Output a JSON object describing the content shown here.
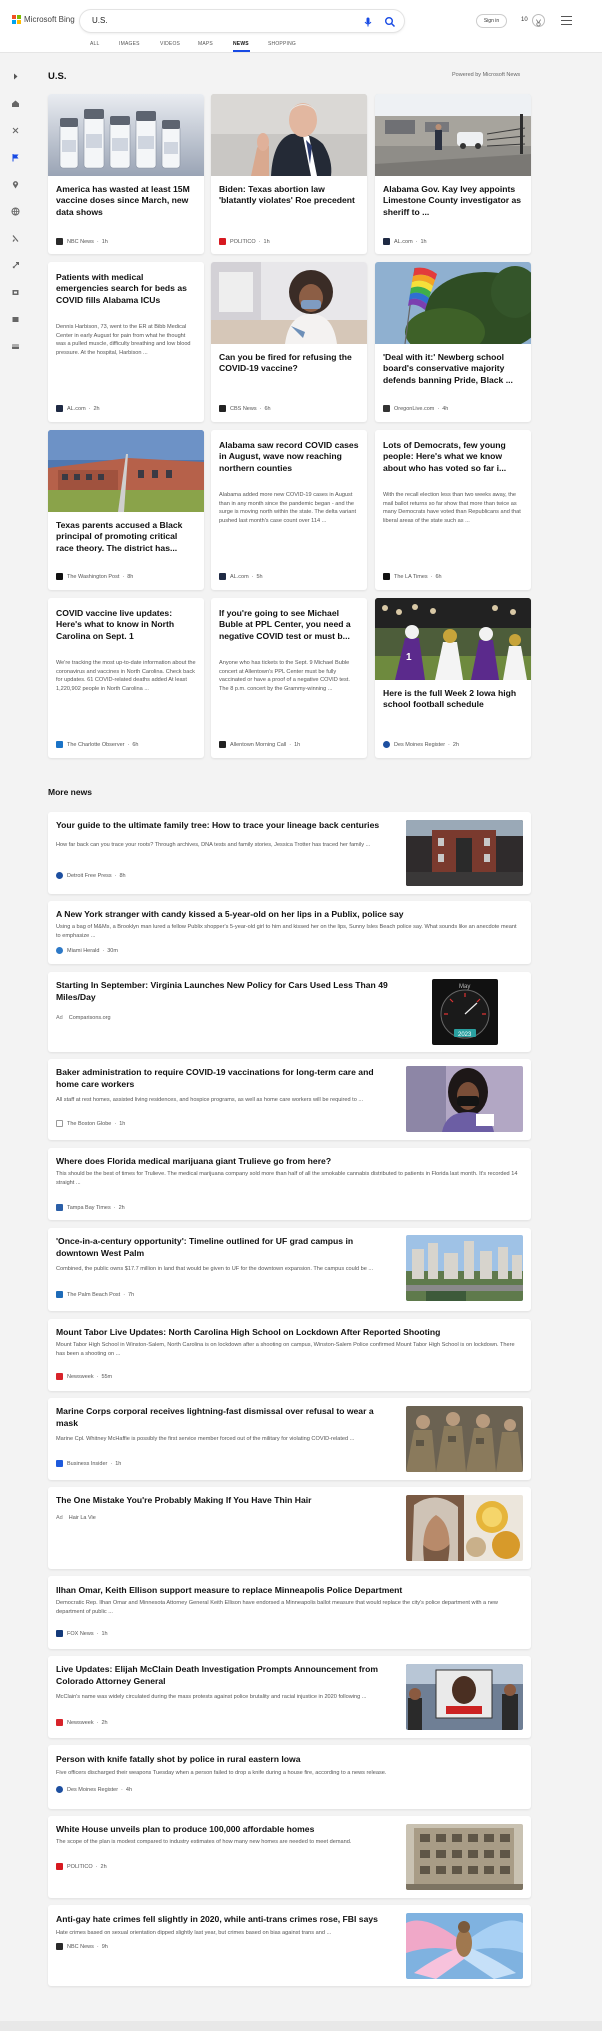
{
  "header": {
    "brand": "Microsoft Bing",
    "search_value": "U.S.",
    "sign_in": "Sign in",
    "points": "10"
  },
  "tabs": [
    {
      "label": "ALL",
      "active": false
    },
    {
      "label": "IMAGES",
      "active": false
    },
    {
      "label": "VIDEOS",
      "active": false
    },
    {
      "label": "MAPS",
      "active": false
    },
    {
      "label": "NEWS",
      "active": true
    },
    {
      "label": "SHOPPING",
      "active": false
    }
  ],
  "sidebar": {
    "icons": [
      "expand-icon",
      "home-icon",
      "sparkle-icon",
      "flag-icon",
      "location-pin-icon",
      "globe-icon",
      "briefcase-icon",
      "rocket-icon",
      "entertainment-icon",
      "sports-icon",
      "money-icon"
    ]
  },
  "section": {
    "title": "U.S.",
    "powered_by": "Powered by Microsoft News"
  },
  "cards": [
    {
      "title": "America has wasted at least 15M vaccine doses since March, new data shows",
      "snippet": "",
      "source": "NBC News",
      "time": "1h",
      "fav_color": "#2a2a2a"
    },
    {
      "title": "Biden: Texas abortion law 'blatantly violates' Roe precedent",
      "snippet": "",
      "source": "POLITICO",
      "time": "1h",
      "fav_color": "#d71920"
    },
    {
      "title": "Alabama Gov. Kay Ivey appoints Limestone County investigator as sheriff to ...",
      "snippet": "",
      "source": "AL.com",
      "time": "1h",
      "fav_color": "#1f2a44"
    },
    {
      "title": "Patients with medical emergencies search for beds as COVID fills Alabama ICUs",
      "snippet": "Dennis Harbison, 73, went to the ER at Bibb Medical Center in early August for pain from what he thought was a pulled muscle, difficulty breathing and low blood pressure. At the hospital, Harbison ...",
      "source": "AL.com",
      "time": "2h",
      "fav_color": "#1f2a44"
    },
    {
      "title": "Can you be fired for refusing the COVID-19 vaccine?",
      "snippet": "",
      "source": "CBS News",
      "time": "6h",
      "fav_color": "#222222"
    },
    {
      "title": "'Deal with it:' Newberg school board's conservative majority defends banning Pride, Black ...",
      "snippet": "",
      "source": "OregonLive.com",
      "time": "4h",
      "fav_color": "#333333"
    },
    {
      "title": "Texas parents accused a Black principal of promoting critical race theory. The district has...",
      "snippet": "",
      "source": "The Washington Post",
      "time": "8h",
      "fav_color": "#111111"
    },
    {
      "title": "Alabama saw record COVID cases in August, wave now reaching northern counties",
      "snippet": "Alabama added more new COVID-19 cases in August than in any month since the pandemic began - and the surge is moving north within the state. The delta variant pushed last month's case count over 114 ...",
      "source": "AL.com",
      "time": "5h",
      "fav_color": "#1f2a44"
    },
    {
      "title": "Lots of Democrats, few young people: Here's what we know about who has voted so far i...",
      "snippet": "With the recall election less than two weeks away, the mail ballot returns so far show that more than twice as many Democrats have voted than Republicans and that liberal areas of the state such as ...",
      "source": "The LA Times",
      "time": "6h",
      "fav_color": "#111111"
    },
    {
      "title": "COVID vaccine live updates: Here's what to know in North Carolina on Sept. 1",
      "snippet": "We're tracking the most up-to-date information about the coronavirus and vaccines in North Carolina. Check back for updates. 61 COVID-related deaths added At least 1,220,902 people in North Carolina ...",
      "source": "The Charlotte Observer",
      "time": "6h",
      "fav_color": "#1a73c7"
    },
    {
      "title": "If you're going to see Michael Buble at PPL Center, you need a negative COVID test or must b...",
      "snippet": "Anyone who has tickets to the Sept. 9 Michael Buble concert at Allentown's PPL Center must be fully vaccinated or have a proof of a negative COVID test. The 8 p.m. concert by the Grammy-winning ...",
      "source": "Allentown Morning Call",
      "time": "1h",
      "fav_color": "#222222"
    },
    {
      "title": "Here is the full Week 2 Iowa high school football schedule",
      "snippet": "",
      "source": "Des Moines Register",
      "time": "2h",
      "fav_color": "#1d4fa0"
    }
  ],
  "more_news": {
    "title": "More news",
    "items": [
      {
        "title": "Your guide to the ultimate family tree: How to trace your lineage back centuries",
        "snippet": "How far back can you trace your roots? Through archives, DNA tests and family stories, Jessica Trotter has traced her family ...",
        "ad": "",
        "source": "Detroit Free Press",
        "time": "8h",
        "fav_color": "#1d4fa0",
        "image": "brick"
      },
      {
        "title": "A New York stranger with candy kissed a 5-year-old on her lips in a Publix, police say",
        "snippet": "Using a bag of M&Ms, a Brooklyn man lured a fellow Publix shopper's 5-year-old girl to him and kissed her on the lips, Sunny Isles Beach police say. What sounds like an anecdote meant to emphasize ...",
        "ad": "",
        "source": "Miami Herald",
        "time": "30m",
        "fav_color": "#2d79c7",
        "image": "none"
      },
      {
        "title": "Starting In September: Virginia Launches New Policy for Cars Used Less Than 49 Miles/Day",
        "snippet": "",
        "ad": "Ad",
        "source": "Comparisons.org",
        "time": "",
        "fav_color": "",
        "image": "gauge"
      },
      {
        "title": "Baker administration to require COVID-19 vaccinations for long-term care and home care workers",
        "snippet": "All staff at rest homes, assisted living residences, and hospice programs, as well as home care workers will be required to ...",
        "ad": "",
        "source": "The Boston Globe",
        "time": "1h",
        "fav_color": "#ffffff",
        "image": "mask"
      },
      {
        "title": "Where does Florida medical marijuana giant Trulieve go from here?",
        "snippet": "This should be the best of times for Trulieve. The medical marijuana company sold more than half of all the smokable cannabis distributed to patients in Florida last month. It's recorded 14 straight ...",
        "ad": "",
        "source": "Tampa Bay Times",
        "time": "2h",
        "fav_color": "#2b5fa8",
        "image": "none"
      },
      {
        "title": "'Once-in-a-century opportunity': Timeline outlined for UF grad campus in downtown West Palm",
        "snippet": "Combined, the public owns $17.7 million in land that would be given to UF for the downtown expansion. The campus could be ...",
        "ad": "",
        "source": "The Palm Beach Post",
        "time": "7h",
        "fav_color": "#1e6bb8",
        "image": "city"
      },
      {
        "title": "Mount Tabor Live Updates: North Carolina High School on Lockdown After Reported Shooting",
        "snippet": "Mount Tabor High School in Winston-Salem, North Carolina is on lockdown after a shooting on campus, Winston-Salem Police confirmed Mount Tabor High School is on lockdown. There has been a shooting on ...",
        "ad": "",
        "source": "Newsweek",
        "time": "55m",
        "fav_color": "#d8232a",
        "image": "none"
      },
      {
        "title": "Marine Corps corporal receives lightning-fast dismissal over refusal to wear a mask",
        "snippet": "Marine Cpl. Whitney McHaffie is possibly the first service member forced out of the military for violating COVID-related ...",
        "ad": "",
        "source": "Business Insider",
        "time": "1h",
        "fav_color": "#1e5adc",
        "image": "troops"
      },
      {
        "title": "The One Mistake You're Probably Making If You Have Thin Hair",
        "snippet": "",
        "ad": "Ad",
        "source": "Hair La Vie",
        "time": "",
        "fav_color": "",
        "image": "hair"
      },
      {
        "title": "Ilhan Omar, Keith Ellison support measure to replace Minneapolis Police Department",
        "snippet": "Democratic Rep. Ilhan Omar and Minnesota Attorney General Keith Ellison have endorsed a Minneapolis ballot measure that would replace the city's police department with a new department of public ...",
        "ad": "",
        "source": "FOX News",
        "time": "1h",
        "fav_color": "#143a7a",
        "image": "none"
      },
      {
        "title": "Live Updates: Elijah McClain Death Investigation Prompts Announcement from Colorado Attorney General",
        "snippet": "McClain's name was widely circulated during the mass protests against police brutality and racial injustice in 2020 following ...",
        "ad": "",
        "source": "Newsweek",
        "time": "2h",
        "fav_color": "#d8232a",
        "image": "protest"
      },
      {
        "title": "Person with knife fatally shot by police in rural eastern Iowa",
        "snippet": "Five officers discharged their weapons Tuesday when a person failed to drop a knife during a house fire, according to a news release.",
        "ad": "",
        "source": "Des Moines Register",
        "time": "4h",
        "fav_color": "#1d4fa0",
        "image": "none"
      },
      {
        "title": "White House unveils plan to produce 100,000 affordable homes",
        "snippet": "The scope of the plan is modest compared to industry estimates of how many new homes are needed to meet demand.",
        "ad": "",
        "source": "POLITICO",
        "time": "2h",
        "fav_color": "#d71920",
        "image": "building"
      },
      {
        "title": "Anti-gay hate crimes fell slightly in 2020, while anti-trans crimes rose, FBI says",
        "snippet": "Hate crimes based on sexual orientation dipped slightly last year, but crimes based on bias against trans and ...",
        "ad": "",
        "source": "NBC News",
        "time": "9h",
        "fav_color": "#2a2a2a",
        "image": "wings"
      }
    ]
  }
}
